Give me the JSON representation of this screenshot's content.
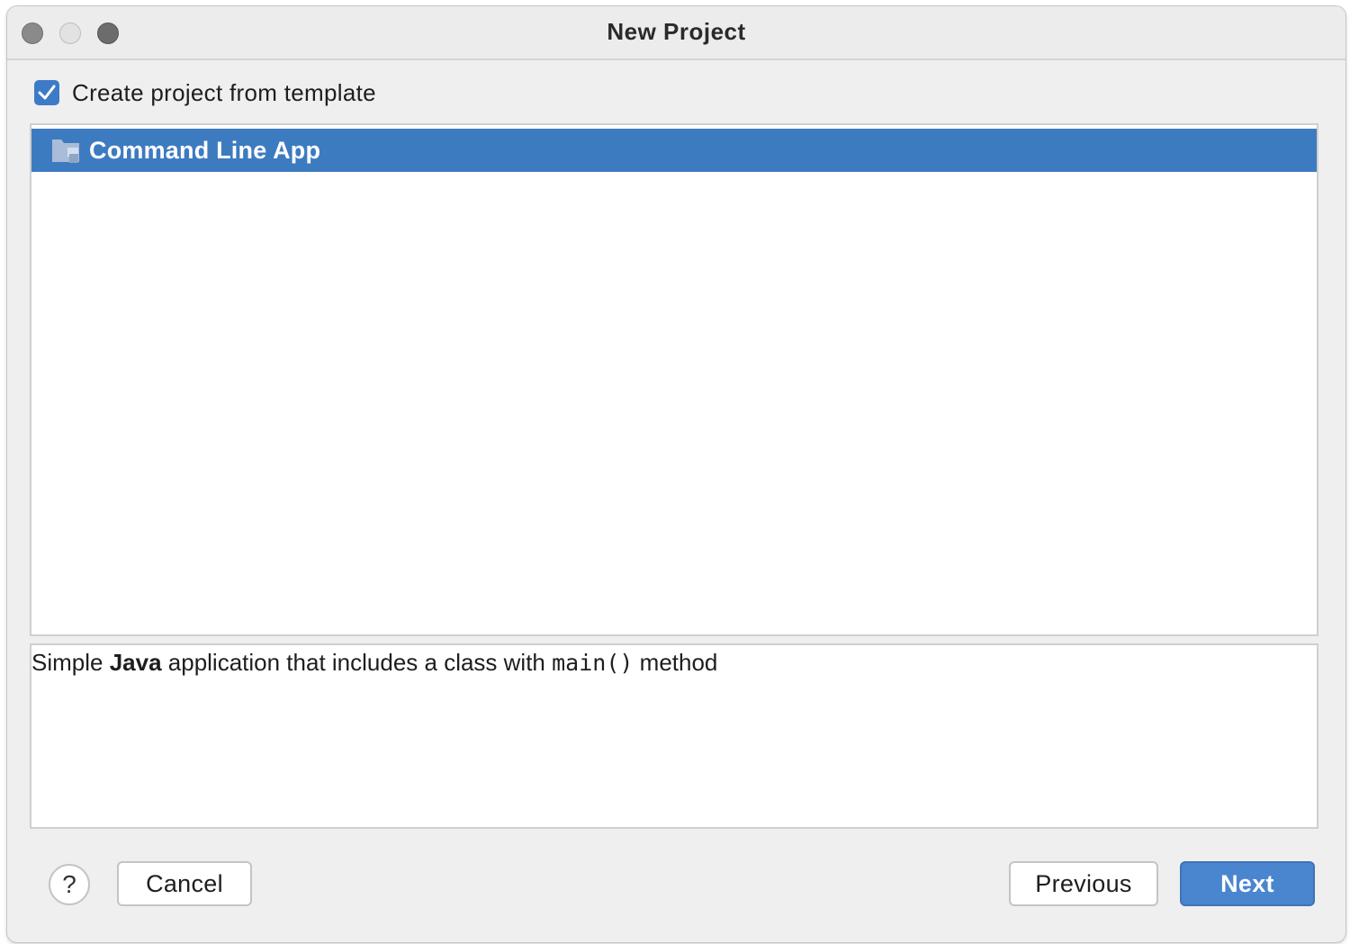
{
  "window": {
    "title": "New Project"
  },
  "template": {
    "checked": true,
    "label": "Create project from template"
  },
  "templates": {
    "items": [
      {
        "label": "Command Line App",
        "icon": "folder-template-icon",
        "selected": true
      }
    ]
  },
  "description": {
    "prefix": "Simple ",
    "bold": "Java",
    "middle": " application that includes a class with ",
    "code": "main()",
    "suffix": " method"
  },
  "buttons": {
    "help": "?",
    "cancel": "Cancel",
    "previous": "Previous",
    "next": "Next"
  },
  "colors": {
    "accent": "#3d7bc1",
    "primary_button": "#4a86cf"
  }
}
